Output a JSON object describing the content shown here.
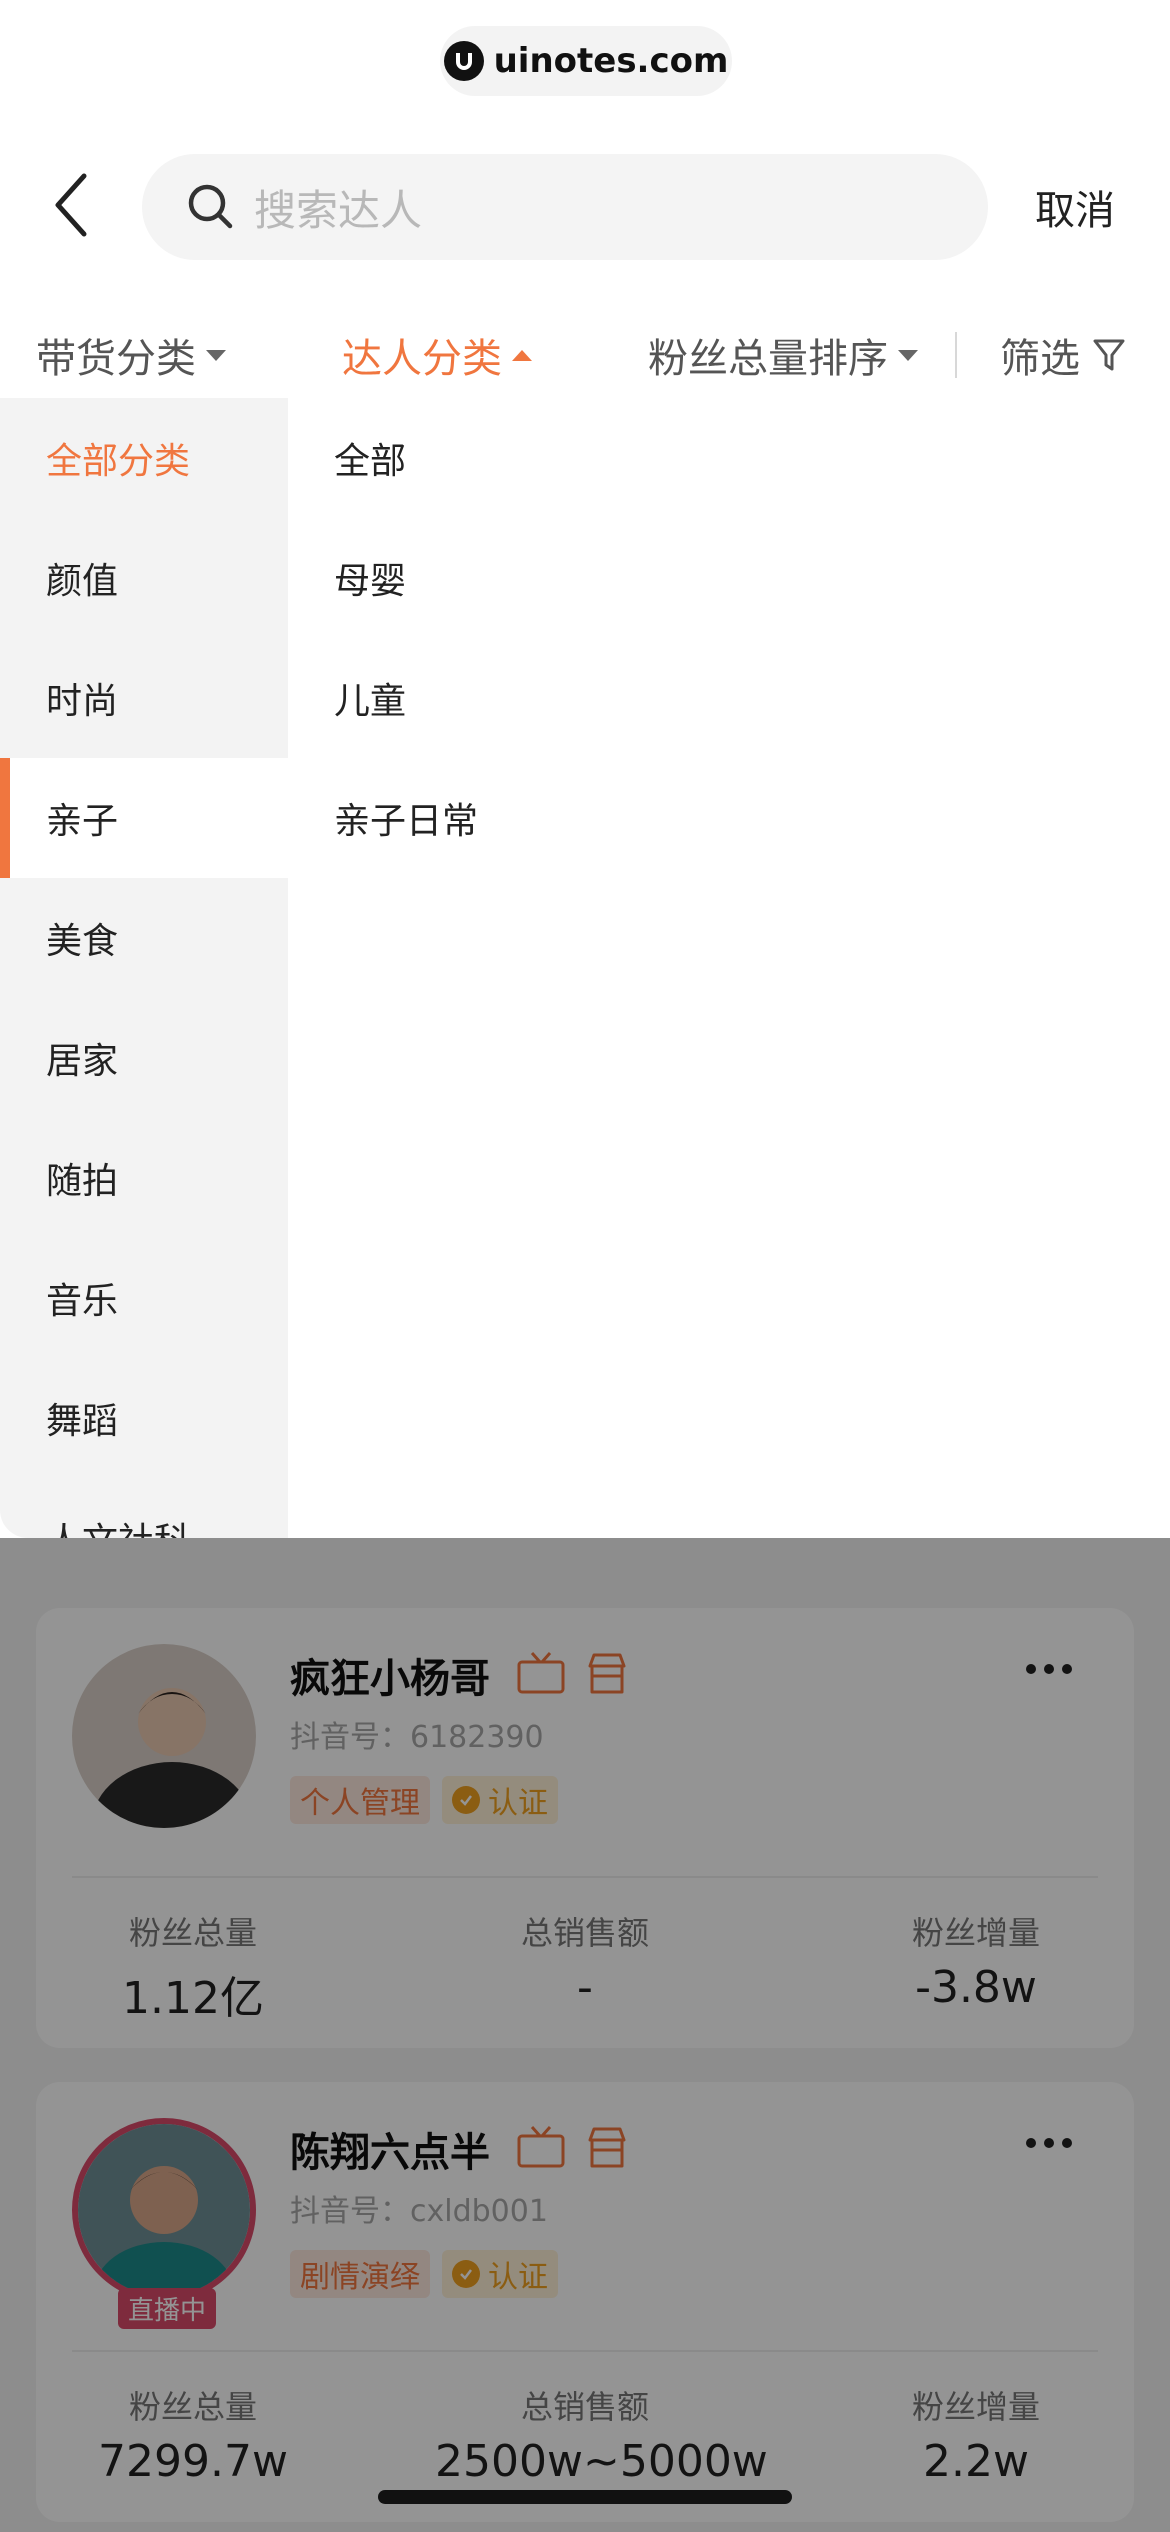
{
  "watermark": {
    "text": "uinotes.com"
  },
  "search": {
    "placeholder": "搜索达人",
    "cancel_label": "取消"
  },
  "filters": {
    "goods_category": "带货分类",
    "creator_category": "达人分类",
    "sort": "粉丝总量排序",
    "filter": "筛选"
  },
  "dropdown": {
    "left_items": [
      "全部分类",
      "颜值",
      "时尚",
      "亲子",
      "美食",
      "居家",
      "随拍",
      "音乐",
      "舞蹈",
      "人文社科"
    ],
    "active_left": "全部分类",
    "selected_left": "亲子",
    "right_items": [
      "全部",
      "母婴",
      "儿童",
      "亲子日常"
    ]
  },
  "cards": [
    {
      "name": "疯狂小杨哥",
      "douyin_id": "抖音号：6182390",
      "category_tag": "个人管理",
      "cert_tag": "认证",
      "stats": [
        {
          "label": "粉丝总量",
          "value": "1.12亿"
        },
        {
          "label": "总销售额",
          "value": "-"
        },
        {
          "label": "粉丝增量",
          "value": "-3.8w"
        }
      ]
    },
    {
      "name": "陈翔六点半",
      "douyin_id": "抖音号：cxldb001",
      "category_tag": "剧情演绎",
      "cert_tag": "认证",
      "live_badge": "直播中",
      "stats": [
        {
          "label": "粉丝总量",
          "value": "7299.7w"
        },
        {
          "label": "总销售额",
          "value": "2500w~5000w"
        },
        {
          "label": "粉丝增量",
          "value": "2.2w"
        }
      ]
    }
  ],
  "colors": {
    "accent": "#f0763f",
    "cert": "#f0a020",
    "live": "#d94a6a"
  }
}
